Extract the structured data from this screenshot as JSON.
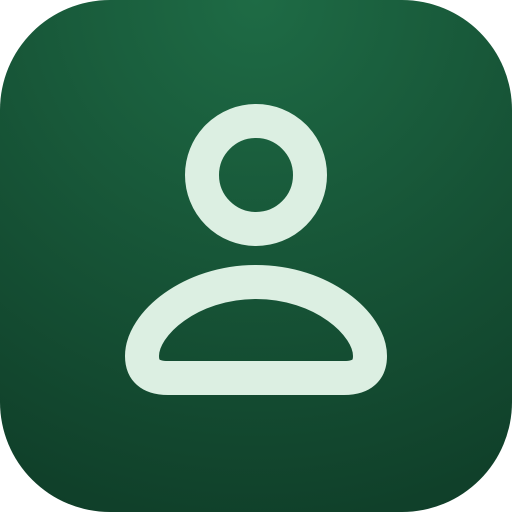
{
  "icon": {
    "name": "user-profile-icon",
    "colors": {
      "background_top": "#1E6B45",
      "background_bottom": "#0F3D28",
      "glyph": "#DCEFE2"
    }
  }
}
